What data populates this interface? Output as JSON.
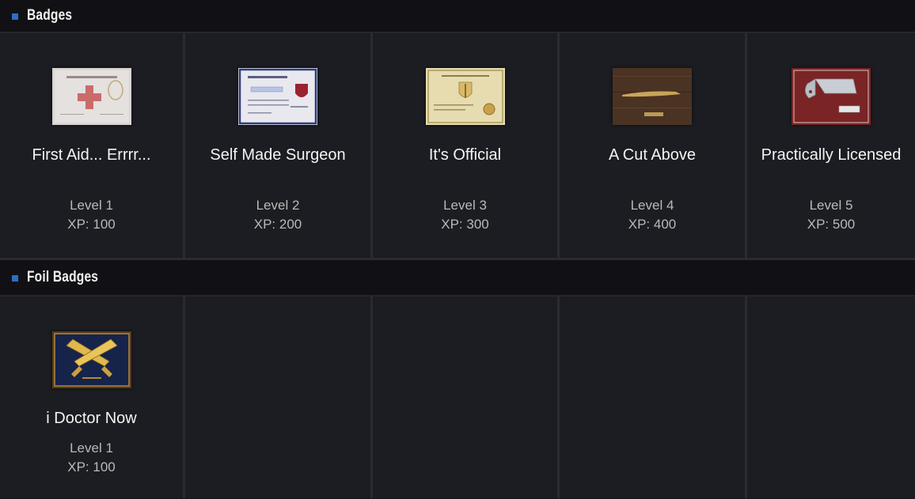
{
  "sections": {
    "badges": {
      "title": "Badges",
      "items": [
        {
          "name": "First Aid... Errrr...",
          "level": "Level 1",
          "xp": "XP: 100",
          "icon": "doctor-certificate-icon"
        },
        {
          "name": "Self Made Surgeon",
          "level": "Level 2",
          "xp": "XP: 200",
          "icon": "university-diploma-icon"
        },
        {
          "name": "It's Official",
          "level": "Level 3",
          "xp": "XP: 300",
          "icon": "official-certificate-icon"
        },
        {
          "name": "A Cut Above",
          "level": "Level 4",
          "xp": "XP: 400",
          "icon": "scalpel-plaque-icon"
        },
        {
          "name": "Practically Licensed",
          "level": "Level 5",
          "xp": "XP: 500",
          "icon": "cleaver-plaque-icon"
        }
      ]
    },
    "foil": {
      "title": "Foil Badges",
      "items": [
        {
          "name": "i Doctor Now",
          "level": "Level 1",
          "xp": "XP: 100",
          "icon": "gold-crossed-cleavers-icon"
        }
      ]
    }
  },
  "colors": {
    "accent": "#2f6dc4",
    "background": "#1c1d22",
    "header": "#111115"
  }
}
